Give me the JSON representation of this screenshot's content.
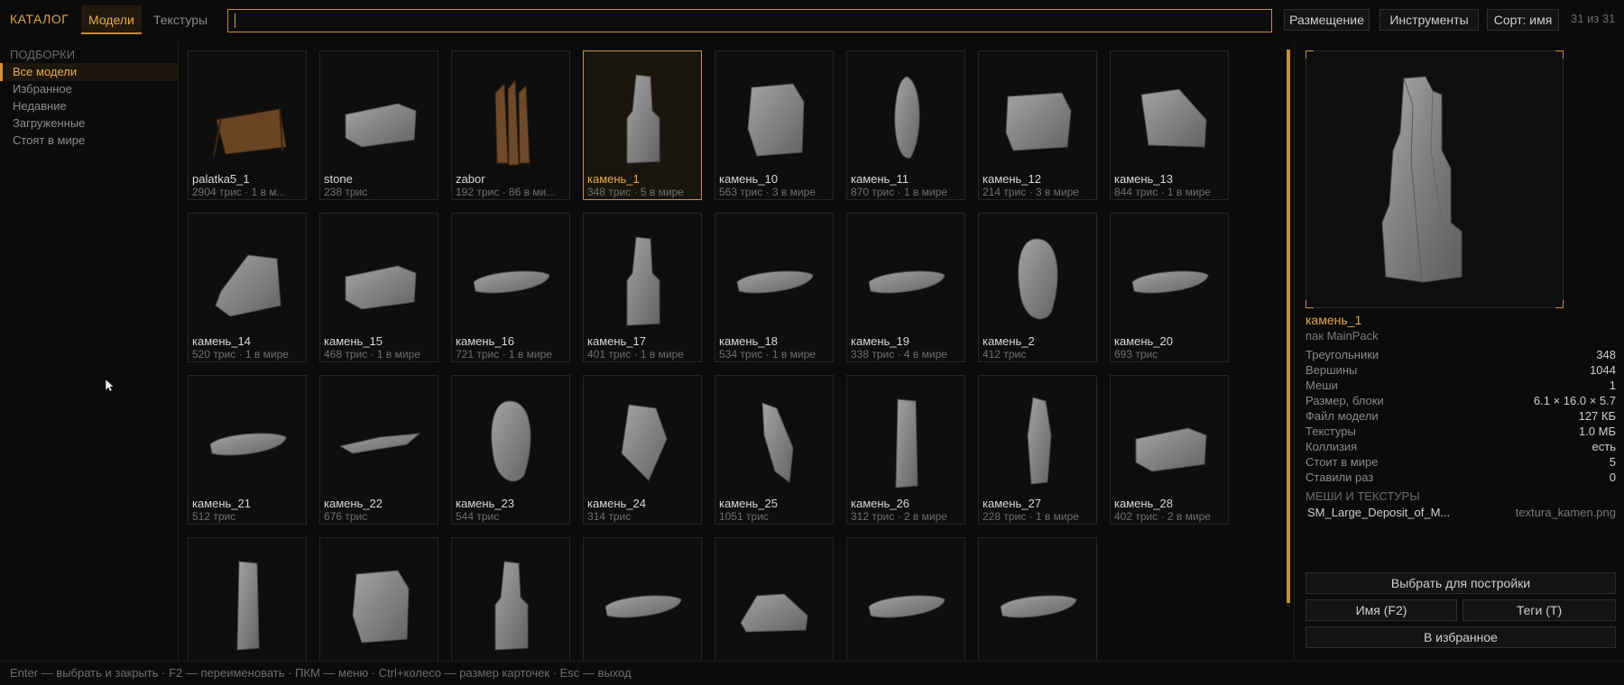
{
  "header": {
    "brand": "КАТАЛОГ",
    "tabs": [
      {
        "label": "Модели",
        "active": true
      },
      {
        "label": "Текстуры",
        "active": false
      }
    ],
    "search_value": "",
    "buttons": {
      "placement": "Размещение",
      "tools": "Инструменты",
      "sort": "Сорт: имя"
    },
    "count": "31 из 31"
  },
  "sidebar": {
    "title": "ПОДБОРКИ",
    "items": [
      {
        "label": "Все модели",
        "active": true
      },
      {
        "label": "Избранное"
      },
      {
        "label": "Недавние"
      },
      {
        "label": "Загруженные"
      },
      {
        "label": "Стоят в мире"
      }
    ]
  },
  "cards": [
    {
      "name": "palatka5_1",
      "meta": "2904 трис · 1 в м...",
      "icon": "tent-model-icon"
    },
    {
      "name": "stone",
      "meta": "238 трис",
      "icon": "stone-model-icon"
    },
    {
      "name": "zabor",
      "meta": "192 трис · 86 в ми...",
      "icon": "fence-model-icon"
    },
    {
      "name": "камень_1",
      "meta": "348 трис · 5 в мире",
      "icon": "rock-model-icon",
      "selected": true
    },
    {
      "name": "камень_10",
      "meta": "563 трис · 3 в мире",
      "icon": "rock-model-icon"
    },
    {
      "name": "камень_11",
      "meta": "870 трис · 1 в мире",
      "icon": "rock-model-icon"
    },
    {
      "name": "камень_12",
      "meta": "214 трис · 3 в мире",
      "icon": "rock-model-icon"
    },
    {
      "name": "камень_13",
      "meta": "844 трис · 1 в мире",
      "icon": "rock-model-icon"
    },
    {
      "name": "камень_14",
      "meta": "520 трис · 1 в мире",
      "icon": "rock-model-icon"
    },
    {
      "name": "камень_15",
      "meta": "468 трис · 1 в мире",
      "icon": "rock-model-icon"
    },
    {
      "name": "камень_16",
      "meta": "721 трис · 1 в мире",
      "icon": "rock-model-icon"
    },
    {
      "name": "камень_17",
      "meta": "401 трис · 1 в мире",
      "icon": "rock-model-icon"
    },
    {
      "name": "камень_18",
      "meta": "534 трис · 1 в мире",
      "icon": "rock-model-icon"
    },
    {
      "name": "камень_19",
      "meta": "338 трис · 4 в мире",
      "icon": "rock-model-icon"
    },
    {
      "name": "камень_2",
      "meta": "412 трис",
      "icon": "rock-model-icon"
    },
    {
      "name": "камень_20",
      "meta": "693 трис",
      "icon": "rock-model-icon"
    },
    {
      "name": "камень_21",
      "meta": "512 трис",
      "icon": "rock-model-icon"
    },
    {
      "name": "камень_22",
      "meta": "676 трис",
      "icon": "rock-model-icon"
    },
    {
      "name": "камень_23",
      "meta": "544 трис",
      "icon": "rock-model-icon"
    },
    {
      "name": "камень_24",
      "meta": "314 трис",
      "icon": "rock-model-icon"
    },
    {
      "name": "камень_25",
      "meta": "1051 трис",
      "icon": "rock-model-icon"
    },
    {
      "name": "камень_26",
      "meta": "312 трис · 2 в мире",
      "icon": "rock-model-icon"
    },
    {
      "name": "камень_27",
      "meta": "228 трис · 1 в мире",
      "icon": "rock-model-icon"
    },
    {
      "name": "камень_28",
      "meta": "402 трис · 2 в мире",
      "icon": "rock-model-icon"
    },
    {
      "name": "",
      "meta": "",
      "icon": "rock-model-icon"
    },
    {
      "name": "",
      "meta": "",
      "icon": "rock-model-icon"
    },
    {
      "name": "",
      "meta": "",
      "icon": "rock-model-icon"
    },
    {
      "name": "",
      "meta": "",
      "icon": "rock-model-icon"
    },
    {
      "name": "",
      "meta": "",
      "icon": "rock-model-icon"
    },
    {
      "name": "",
      "meta": "",
      "icon": "rock-model-icon"
    },
    {
      "name": "",
      "meta": "",
      "icon": "rock-model-icon"
    }
  ],
  "panel": {
    "name": "камень_1",
    "pack": "пак MainPack",
    "stats": [
      {
        "k": "Треугольники",
        "v": "348"
      },
      {
        "k": "Вершины",
        "v": "1044"
      },
      {
        "k": "Меши",
        "v": "1"
      },
      {
        "k": "Размер, блоки",
        "v": "6.1 × 16.0 × 5.7"
      },
      {
        "k": "Файл модели",
        "v": "127 КБ"
      },
      {
        "k": "Текстуры",
        "v": "1.0 МБ"
      },
      {
        "k": "Коллизия",
        "v": "есть"
      },
      {
        "k": "Стоит в мире",
        "v": "5"
      },
      {
        "k": "Ставили раз",
        "v": "0"
      }
    ],
    "meshes_title": "МЕШИ И ТЕКСТУРЫ",
    "mesh": "SM_Large_Deposit_of_M...",
    "texture": "textura_kamen.png",
    "actions": {
      "select": "Выбрать для постройки",
      "rename": "Имя (F2)",
      "tags": "Теги (T)",
      "favorite": "В избранное"
    }
  },
  "footer": "Enter — выбрать и закрыть · F2 — переименовать · ПКМ — меню · Ctrl+колесо — размер карточек · Esc — выход",
  "colors": {
    "accent": "#d9a555",
    "background": "#0b0b0b",
    "border": "#262626"
  }
}
